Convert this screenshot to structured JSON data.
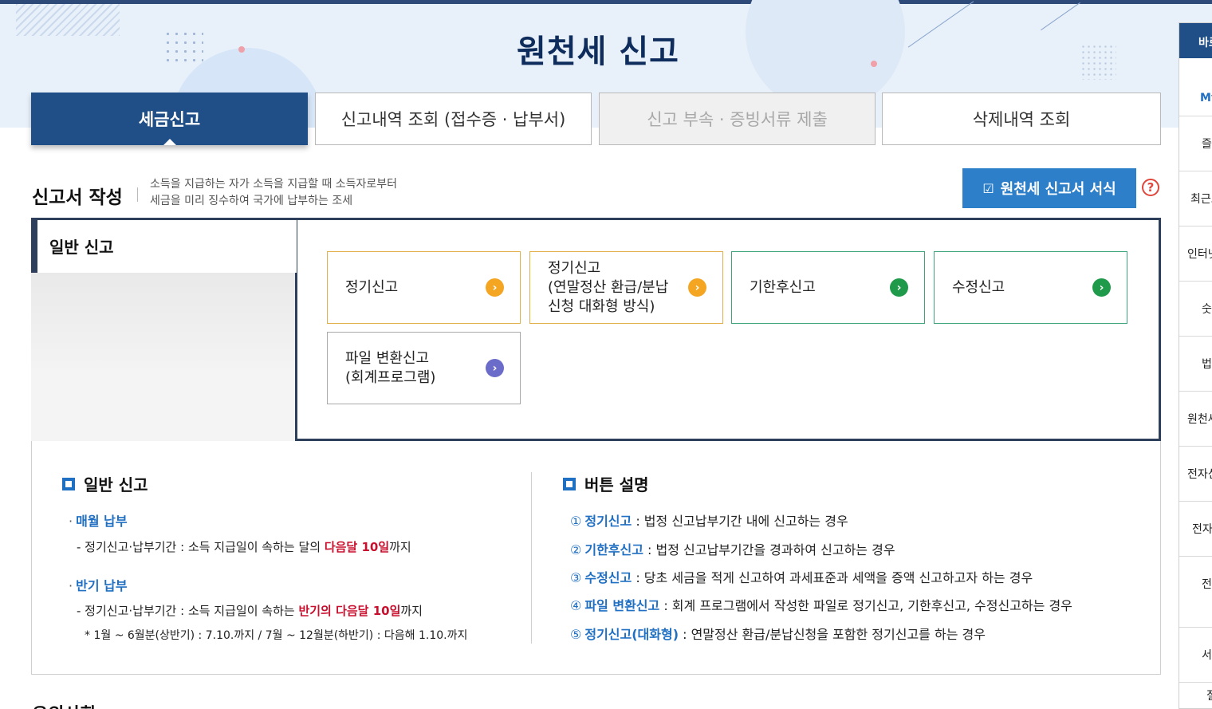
{
  "page": {
    "title": "원천세 신고"
  },
  "tabs": [
    {
      "label": "세금신고",
      "state": "active"
    },
    {
      "label": "신고내역 조회 (접수증 · 납부서)",
      "state": "normal"
    },
    {
      "label": "신고 부속 · 증빙서류 제출",
      "state": "disabled"
    },
    {
      "label": "삭제내역 조회",
      "state": "normal"
    }
  ],
  "section": {
    "title": "신고서 작성",
    "desc_line1": "소득을 지급하는 자가 소득을 지급할 때 소득자로부터",
    "desc_line2": "세금을 미리 징수하여 국가에 납부하는 조세",
    "form_button": "원천세 신고서 서식",
    "help_symbol": "?"
  },
  "general_filing": {
    "label": "일반 신고",
    "cards": [
      {
        "label": "정기신고",
        "color": "orange"
      },
      {
        "label": "정기신고\n(연말정산 환급/분납\n신청 대화형 방식)",
        "color": "orange"
      },
      {
        "label": "기한후신고",
        "color": "green"
      },
      {
        "label": "수정신고",
        "color": "green"
      },
      {
        "label": "파일 변환신고\n(회계프로그램)",
        "color": "purple"
      }
    ],
    "arrow_symbol": "›"
  },
  "info": {
    "left": {
      "heading": "일반 신고",
      "monthly": {
        "title": "매월 납부",
        "line_prefix": "- 정기신고·납부기간 : 소득 지급일이 속하는 달의 ",
        "line_highlight": "다음달 10일",
        "line_suffix": "까지"
      },
      "halfyear": {
        "title": "반기 납부",
        "line_prefix": "- 정기신고·납부기간 : 소득 지급일이 속하는 ",
        "line_highlight": "반기의 다음달 10일",
        "line_suffix": "까지",
        "note": "* 1월 ~ 6월분(상반기) : 7.10.까지 / 7월 ~ 12월분(하반기) : 다음해 1.10.까지"
      }
    },
    "right": {
      "heading": "버튼 설명",
      "items": [
        {
          "num": "①",
          "term": "정기신고",
          "desc": " : 법정 신고납부기간 내에 신고하는 경우"
        },
        {
          "num": "②",
          "term": "기한후신고",
          "desc": " : 법정 신고납부기간을 경과하여 신고하는 경우"
        },
        {
          "num": "③",
          "term": "수정신고",
          "desc": " : 당초 세금을 적게 신고하여 과세표준과 세액을 증액 신고하고자 하는 경우"
        },
        {
          "num": "④",
          "term": "파일 변환신고",
          "desc": " : 회계 프로그램에서 작성한 파일로 정기신고, 기한후신고, 수정신고하는 경우"
        },
        {
          "num": "⑤",
          "term": "정기신고(대화형)",
          "desc": " : 연말정산 환급/분납신청을 포함한 정기신고를 하는 경우"
        }
      ]
    }
  },
  "next_section_title": "유의사항",
  "quick_menu": {
    "head": "바로가기",
    "my": "My",
    "items": [
      "즐겨찾기",
      "최근조회",
      "인터넷",
      "숫자",
      "법령",
      "원천세",
      "전자신고",
      "전자",
      "전자가",
      "서식",
      "질"
    ]
  },
  "colors": {
    "navy": "#1f4f86",
    "accent_blue": "#2c7fc8",
    "orange": "#f4a623",
    "green": "#1f9a4a",
    "purple": "#6b6bc9",
    "red": "#c8102e"
  }
}
